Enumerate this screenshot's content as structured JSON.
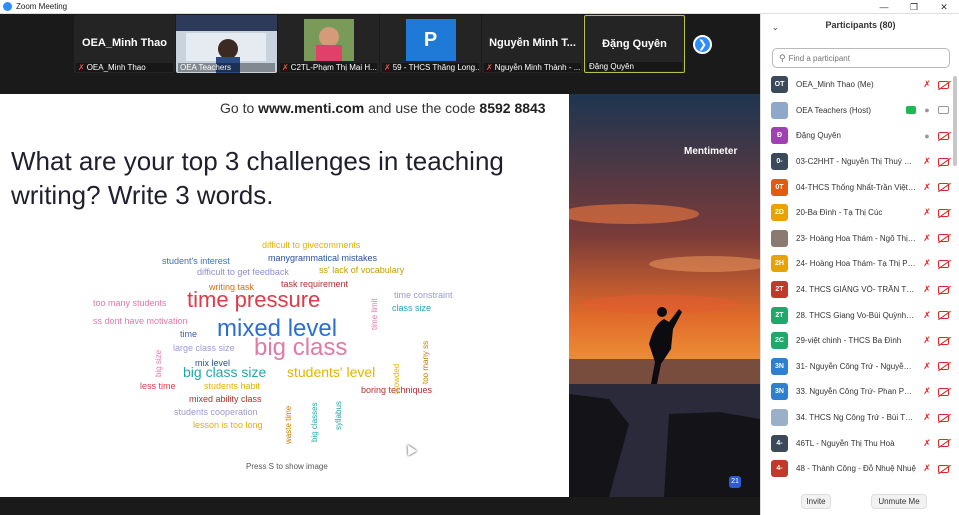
{
  "window": {
    "title": "Zoom Meeting"
  },
  "thumbnails": [
    {
      "name": "OEA_Minh Thao",
      "label": "OEA_Minh Thao",
      "muted": true,
      "kind": "name"
    },
    {
      "name": "",
      "label": "OEA Teachers",
      "muted": false,
      "kind": "video"
    },
    {
      "name": "",
      "label": "C2TL-Phạm Thị Mai H...",
      "muted": true,
      "kind": "photo"
    },
    {
      "name": "P",
      "label": "59 - THCS Thăng Long...",
      "muted": true,
      "kind": "letter"
    },
    {
      "name": "Nguyễn Minh T...",
      "label": "Nguyễn Minh Thành - ...",
      "muted": true,
      "kind": "name"
    },
    {
      "name": "Đặng Quyên",
      "label": "Đặng Quyên",
      "muted": false,
      "kind": "name"
    }
  ],
  "slide": {
    "code_prefix": "Go to ",
    "code_site": "www.menti.com",
    "code_middle": " and use the code ",
    "code_value": "8592 8843",
    "question": "What are your top 3 challenges in teaching writing? Write 3 words.",
    "press_hint": "Press S to show image",
    "brand": "Mentimeter",
    "badge": "21"
  },
  "wordcloud": [
    {
      "text": "difficult to givecomments",
      "color": "#e0b400",
      "size": 9
    },
    {
      "text": "student's interest",
      "color": "#3a6fc4",
      "size": 9
    },
    {
      "text": "manygrammatical mistakes",
      "color": "#2a4f9c",
      "size": 9
    },
    {
      "text": "difficult to get feedback",
      "color": "#8a8fd6",
      "size": 9
    },
    {
      "text": "ss' lack of vocabulary",
      "color": "#c89a00",
      "size": 9
    },
    {
      "text": "writing task",
      "color": "#c87a00",
      "size": 9
    },
    {
      "text": "task requirement",
      "color": "#b03030",
      "size": 9
    },
    {
      "text": "too many students",
      "color": "#e07aa8",
      "size": 9
    },
    {
      "text": "time pressure",
      "color": "#e03a4a",
      "size": 22
    },
    {
      "text": "time constraint",
      "color": "#9a9ad0",
      "size": 9
    },
    {
      "text": "class size",
      "color": "#1fa8a8",
      "size": 9
    },
    {
      "text": "ss dont have motivation",
      "color": "#e07aa8",
      "size": 9
    },
    {
      "text": "mixed level",
      "color": "#2d6fd0",
      "size": 24
    },
    {
      "text": "time",
      "color": "#3a5fb0",
      "size": 9
    },
    {
      "text": "large class size",
      "color": "#9a9ad0",
      "size": 9
    },
    {
      "text": "big class",
      "color": "#e07aa8",
      "size": 24
    },
    {
      "text": "mix level",
      "color": "#2a4f9c",
      "size": 9
    },
    {
      "text": "big class size",
      "color": "#1fa8a8",
      "size": 14
    },
    {
      "text": "students' level",
      "color": "#e0b400",
      "size": 14
    },
    {
      "text": "less time",
      "color": "#e03a4a",
      "size": 9
    },
    {
      "text": "students habit",
      "color": "#e0b400",
      "size": 9
    },
    {
      "text": "boring techniques",
      "color": "#b03030",
      "size": 9
    },
    {
      "text": "mixed ability class",
      "color": "#b03030",
      "size": 9
    },
    {
      "text": "students cooperation",
      "color": "#9a9ad0",
      "size": 9
    },
    {
      "text": "lesson is too long",
      "color": "#e0b400",
      "size": 9
    }
  ],
  "wordcloud_vertical": [
    {
      "text": "time limit",
      "color": "#e07aa8",
      "size": 8
    },
    {
      "text": "too many ss",
      "color": "#c87a00",
      "size": 8
    },
    {
      "text": "big size",
      "color": "#e07aa8",
      "size": 8
    },
    {
      "text": "crowded",
      "color": "#e0b400",
      "size": 8
    },
    {
      "text": "waste time",
      "color": "#c87a00",
      "size": 8
    },
    {
      "text": "big classes",
      "color": "#1fa8a8",
      "size": 8
    },
    {
      "text": "syllabus",
      "color": "#1fa8a8",
      "size": 8
    }
  ],
  "panel": {
    "title": "Participants (80)",
    "search_placeholder": "Find a participant",
    "invite": "Invite",
    "unmute_me": "Unmute Me"
  },
  "participants": [
    {
      "initials": "OT",
      "color": "#3b4a5a",
      "name": "OEA_Minh Thao (Me)",
      "mic": "off",
      "cam": "off",
      "screen": false
    },
    {
      "initials": "",
      "color": "#8fa7c8",
      "name": "OEA Teachers (Host)",
      "mic": "on",
      "cam": "on",
      "screen": true
    },
    {
      "initials": "Đ",
      "color": "#a13fb5",
      "name": "Đặng Quyên",
      "mic": "on",
      "cam": "off",
      "screen": false
    },
    {
      "initials": "0-",
      "color": "#3b4a5a",
      "name": "03-C2HHT - Nguyễn Thị Thuý Liên",
      "mic": "off",
      "cam": "off",
      "screen": false
    },
    {
      "initials": "0T",
      "color": "#e05a10",
      "name": "04-THCS Thống Nhất-Trần Việt Hà",
      "mic": "off",
      "cam": "off",
      "screen": false
    },
    {
      "initials": "2D",
      "color": "#e8a300",
      "name": "20-Ba Đình - Tạ Thị Cúc",
      "mic": "off",
      "cam": "off",
      "screen": false
    },
    {
      "initials": "",
      "color": "#8a7a70",
      "name": "23- Hoàng Hoa Thám - Ngô Thị X...",
      "mic": "off",
      "cam": "off",
      "screen": false
    },
    {
      "initials": "2H",
      "color": "#e8a300",
      "name": "24- Hoàng Hoa Thám- Tạ Thị Phấn",
      "mic": "off",
      "cam": "off",
      "screen": false
    },
    {
      "initials": "2T",
      "color": "#c0392b",
      "name": "24. THCS GIẢNG VÕ- TRẦN THU ...",
      "mic": "off",
      "cam": "off",
      "screen": false
    },
    {
      "initials": "2T",
      "color": "#1fa86a",
      "name": "28. THCS Giang Vo-Bùi Quỳnh Tr...",
      "mic": "off",
      "cam": "off",
      "screen": false
    },
    {
      "initials": "2C",
      "color": "#1fa86a",
      "name": "29-việt chinh - THCS Ba Đình",
      "mic": "off",
      "cam": "off",
      "screen": false
    },
    {
      "initials": "3N",
      "color": "#2d7fd0",
      "name": "31- Nguyễn Công Trứ - Nguyễn T...",
      "mic": "off",
      "cam": "off",
      "screen": false
    },
    {
      "initials": "3N",
      "color": "#2d7fd0",
      "name": "33. Nguyễn Công Trứ- Phan Phuo...",
      "mic": "off",
      "cam": "off",
      "screen": false
    },
    {
      "initials": "",
      "color": "#9ab0c8",
      "name": "34. THCS Ng Công Trứ - Bùi Thuỷ",
      "mic": "off",
      "cam": "off",
      "screen": false
    },
    {
      "initials": "4-",
      "color": "#3b4a5a",
      "name": "46TL - Nguyễn Thị Thu Hoà",
      "mic": "off",
      "cam": "off",
      "screen": false
    },
    {
      "initials": "4-",
      "color": "#c0392b",
      "name": "48 - Thành Công - Đỗ Nhuệ Nhuệ",
      "mic": "off",
      "cam": "off",
      "screen": false
    }
  ]
}
